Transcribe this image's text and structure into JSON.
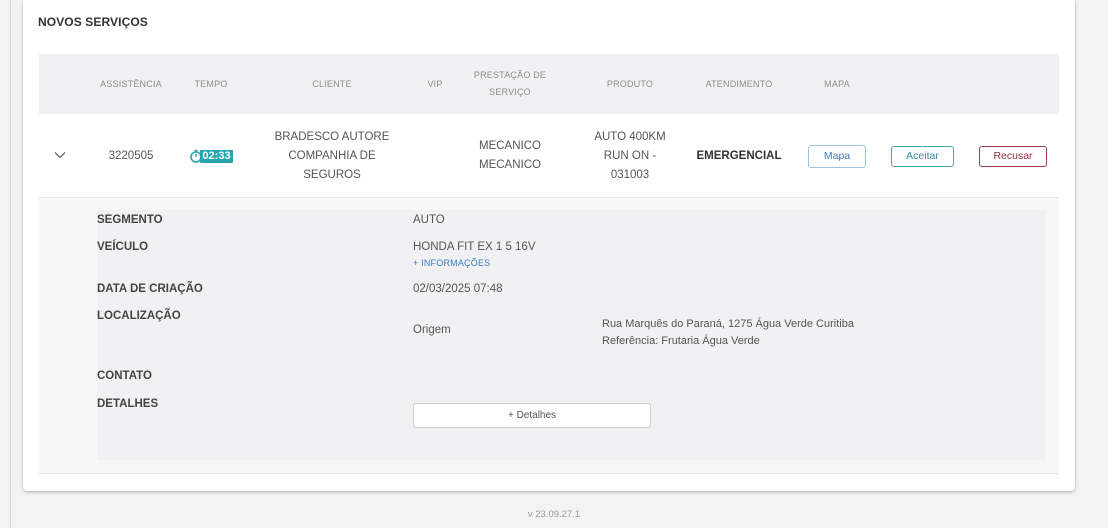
{
  "section": {
    "title": "NOVOS SERVIÇOS"
  },
  "table": {
    "headers": {
      "assistencia": "ASSISTÊNCIA",
      "tempo": "TEMPO",
      "cliente": "CLIENTE",
      "vip": "VIP",
      "prestacao_line1": "PRESTAÇÃO DE",
      "prestacao_line2": "SERVIÇO",
      "produto": "PRODUTO",
      "atendimento": "ATENDIMENTO",
      "mapa": "MAPA"
    },
    "row": {
      "assistencia": "3220505",
      "tempo": "02:33",
      "cliente_lines": [
        "BRADESCO AUTORE",
        "COMPANHIA DE",
        "SEGUROS"
      ],
      "vip": "",
      "prestacao_lines": [
        "MECANICO",
        "MECANICO"
      ],
      "produto_lines": [
        "AUTO 400KM",
        "RUN ON -",
        "031003"
      ],
      "atendimento": "EMERGENCIAL",
      "mapa_label": "Mapa",
      "aceitar_label": "Aceitar",
      "recusar_label": "Recusar"
    }
  },
  "details": {
    "segmento_label": "SEGMENTO",
    "segmento_value": "AUTO",
    "veiculo_label": "VEÍCULO",
    "veiculo_value": "HONDA FIT EX 1 5 16V",
    "mais_informacoes": "+ INFORMAÇÕES",
    "data_label": "DATA DE CRIAÇÃO",
    "data_value": "02/03/2025 07:48",
    "localizacao_label": "LOCALIZAÇÃO",
    "origem_label": "Origem",
    "endereco": "Rua Marquês do Paraná, 1275 Água Verde Curitiba",
    "referencia": "Referência: Frutaria Água Verde",
    "contato_label": "CONTATO",
    "detalhes_label": "DETALHES",
    "detalhes_button": "+ Detalhes"
  },
  "footer": {
    "version": "v 23.09.27.1"
  },
  "colors": {
    "accent_blue": "#3a7cc0",
    "accept_teal": "#2f8d98",
    "reject_red": "#8c2d3b",
    "timer_teal": "#2aa5ad"
  },
  "icons": {
    "expand": "chevron-down-icon",
    "timer": "stopwatch-icon"
  }
}
